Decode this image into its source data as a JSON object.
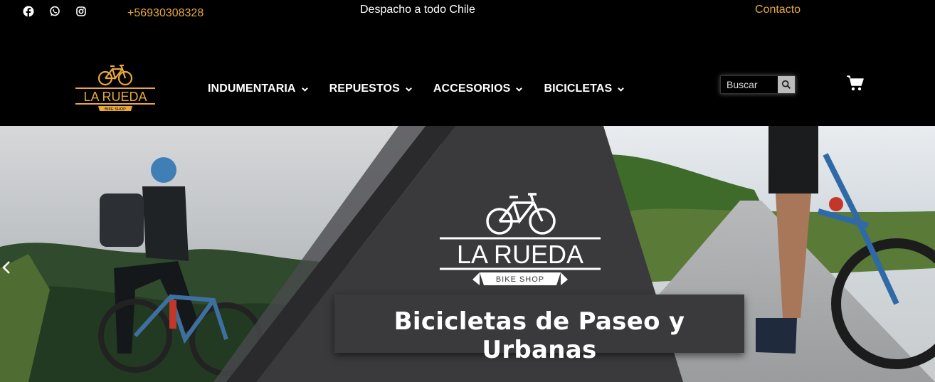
{
  "topbar": {
    "social": [
      {
        "name": "facebook-icon"
      },
      {
        "name": "whatsapp-icon"
      },
      {
        "name": "instagram-icon"
      }
    ],
    "phone": "+56930308328",
    "shipping_text": "Despacho a todo Chile",
    "contact_link": "Contacto"
  },
  "header": {
    "logo": {
      "main": "LA RUEDA",
      "sub": "BIKE SHOP"
    },
    "nav": [
      {
        "label": "INDUMENTARIA",
        "icon": "chevron-down-icon"
      },
      {
        "label": "REPUESTOS",
        "icon": "chevron-down-icon"
      },
      {
        "label": "ACCESORIOS",
        "icon": "chevron-down-icon"
      },
      {
        "label": "BICICLETAS",
        "icon": "chevron-down-icon"
      }
    ],
    "search": {
      "placeholder": "Buscar",
      "icon": "search-icon"
    },
    "cart_icon": "cart-icon"
  },
  "hero": {
    "logo": {
      "main": "LA RUEDA",
      "sub": "BIKE SHOP"
    },
    "headline": "Bicicletas de Paseo y Urbanas",
    "prev_icon": "chevron-left-icon"
  },
  "colors": {
    "accent": "#e8a93a",
    "background": "#000000",
    "banner": "#3a3a3c"
  }
}
